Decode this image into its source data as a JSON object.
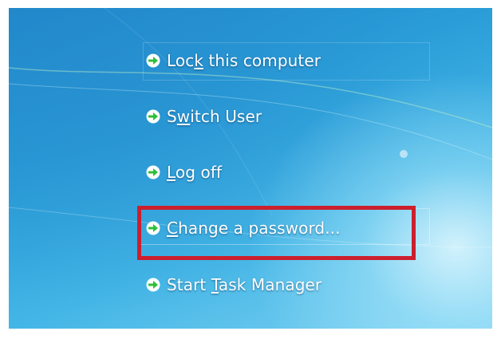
{
  "menu": {
    "items": [
      {
        "pre": "Loc",
        "key": "k",
        "post": " this computer"
      },
      {
        "pre": "S",
        "key": "w",
        "post": "itch User"
      },
      {
        "pre": "",
        "key": "L",
        "post": "og off"
      },
      {
        "pre": "",
        "key": "C",
        "post": "hange a password..."
      },
      {
        "pre": "Start ",
        "key": "T",
        "post": "ask Manager"
      }
    ]
  },
  "colors": {
    "arrow_green": "#2fbf3a",
    "highlight_red": "#cc1f2d",
    "background_blue": "#2a9dd8"
  },
  "icons": {
    "item_icon": "green-right-arrow-icon"
  },
  "highlighted_item": "change-password"
}
